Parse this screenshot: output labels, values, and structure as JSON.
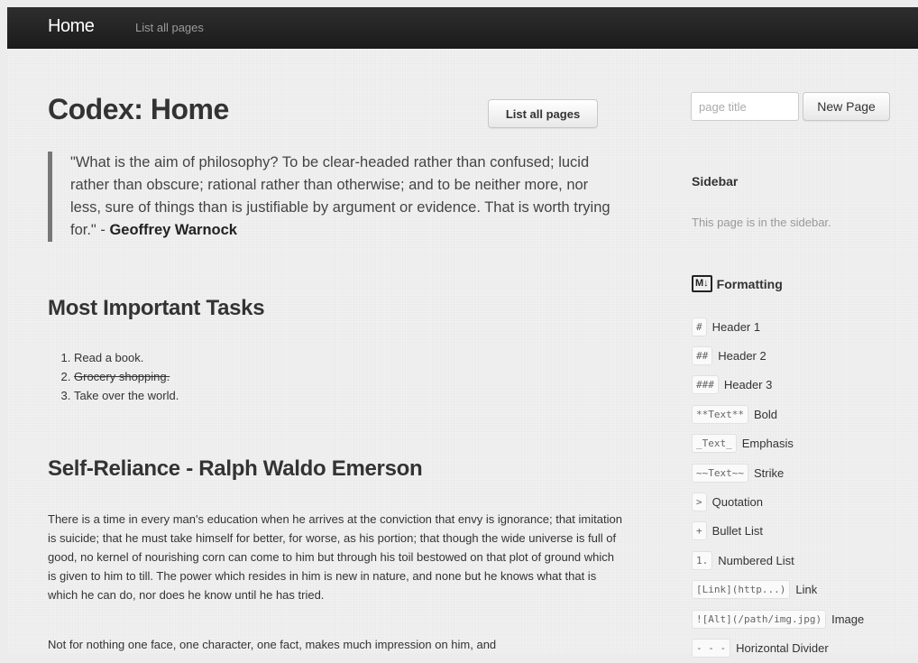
{
  "nav": {
    "brand": "Home",
    "link": "List all pages"
  },
  "main": {
    "title": "Codex: Home",
    "list_button": "List all pages",
    "quote": {
      "text": "\"What is the aim of philosophy? To be clear-headed rather than confused; lucid rather than obscure; rational rather than otherwise; and to be neither more, nor less, sure of things than is justifiable by argument or evidence. That is worth trying for.\" - ",
      "author": "Geoffrey Warnock"
    },
    "tasks_heading": "Most Important Tasks",
    "tasks": [
      {
        "text": "Read a book.",
        "done": false
      },
      {
        "text": "Grocery shopping.",
        "done": true
      },
      {
        "text": "Take over the world.",
        "done": false
      }
    ],
    "essay_heading": "Self-Reliance - Ralph Waldo Emerson",
    "paragraphs": [
      "There is a time in every man's education when he arrives at the conviction that envy is ignorance; that imitation is suicide; that he must take himself for better, for worse, as his portion; that though the wide universe is full of good, no kernel of nourishing corn can come to him but through his toil bestowed on that plot of ground which is given to him to till. The power which resides in him is new in nature, and none but he knows what that is which he can do, nor does he know until he has tried.",
      "Not for nothing one face, one character, one fact, makes much impression on him, and"
    ]
  },
  "sidebar": {
    "title_placeholder": "page title",
    "new_page_button": "New Page",
    "sidebar_heading": "Sidebar",
    "sidebar_note": "This page is in the sidebar.",
    "formatting_heading": "Formatting",
    "formatting_icon": "markdown-icon",
    "formatting_icon_text": "M↓",
    "formatting": [
      {
        "code": "#",
        "label": "Header 1"
      },
      {
        "code": "##",
        "label": "Header 2"
      },
      {
        "code": "###",
        "label": "Header 3"
      },
      {
        "code": "**Text**",
        "label": "Bold"
      },
      {
        "code": "_Text_",
        "label": "Emphasis"
      },
      {
        "code": "~~Text~~",
        "label": "Strike"
      },
      {
        "code": ">",
        "label": "Quotation"
      },
      {
        "code": "+",
        "label": "Bullet List"
      },
      {
        "code": "1.",
        "label": "Numbered List"
      },
      {
        "code": "[Link](http...)",
        "label": "Link"
      },
      {
        "code": "![Alt](/path/img.jpg)",
        "label": "Image"
      },
      {
        "code": "- - -",
        "label": "Horizontal Divider"
      }
    ]
  },
  "colors": {
    "navbar": "#222222",
    "page_background": "#f0f0f0",
    "quote_border": "#777777"
  }
}
